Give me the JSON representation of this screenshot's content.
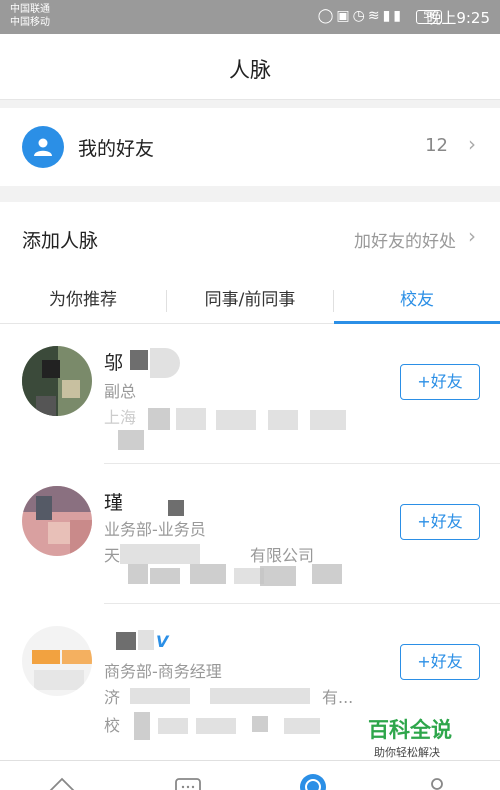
{
  "status_bar": {
    "carrier_1": "中国联通",
    "carrier_2": "中国移动",
    "icons": [
      "headset-icon",
      "vibrate-icon",
      "alarm-icon",
      "hd-icon",
      "wifi-icon",
      "signal-3g-icon",
      "signal-4g-icon"
    ],
    "battery": "56",
    "time": "晚上9:25"
  },
  "header": {
    "title": "人脉"
  },
  "my_friends": {
    "label": "我的好友",
    "count": "12"
  },
  "add_contacts": {
    "title": "添加人脉",
    "benefit_link": "加好友的好处",
    "tabs": [
      {
        "label": "为你推荐",
        "active": false
      },
      {
        "label": "同事/前同事",
        "active": false
      },
      {
        "label": "校友",
        "active": true
      }
    ]
  },
  "contacts": [
    {
      "name": "邬",
      "line1": "副总",
      "line2": "上海",
      "line3": "",
      "button": "+好友"
    },
    {
      "name": "瑾",
      "line1": "业务部-业务员",
      "line2": "天",
      "line2_suffix": "有限公司",
      "line3": "",
      "button": "+好友"
    },
    {
      "name": "",
      "line1": "商务部-商务经理",
      "line2": "济",
      "line2_suffix": "有...",
      "line3": "校",
      "button": "+好友"
    }
  ],
  "bottom_nav": {
    "icons": [
      "home-icon",
      "message-icon",
      "contacts-icon",
      "profile-icon"
    ]
  },
  "watermark": {
    "title": "百科全说",
    "subtitle": "助你轻松解决"
  },
  "colors": {
    "accent": "#2b8fe6",
    "watermark_green": "#2ea64b"
  }
}
